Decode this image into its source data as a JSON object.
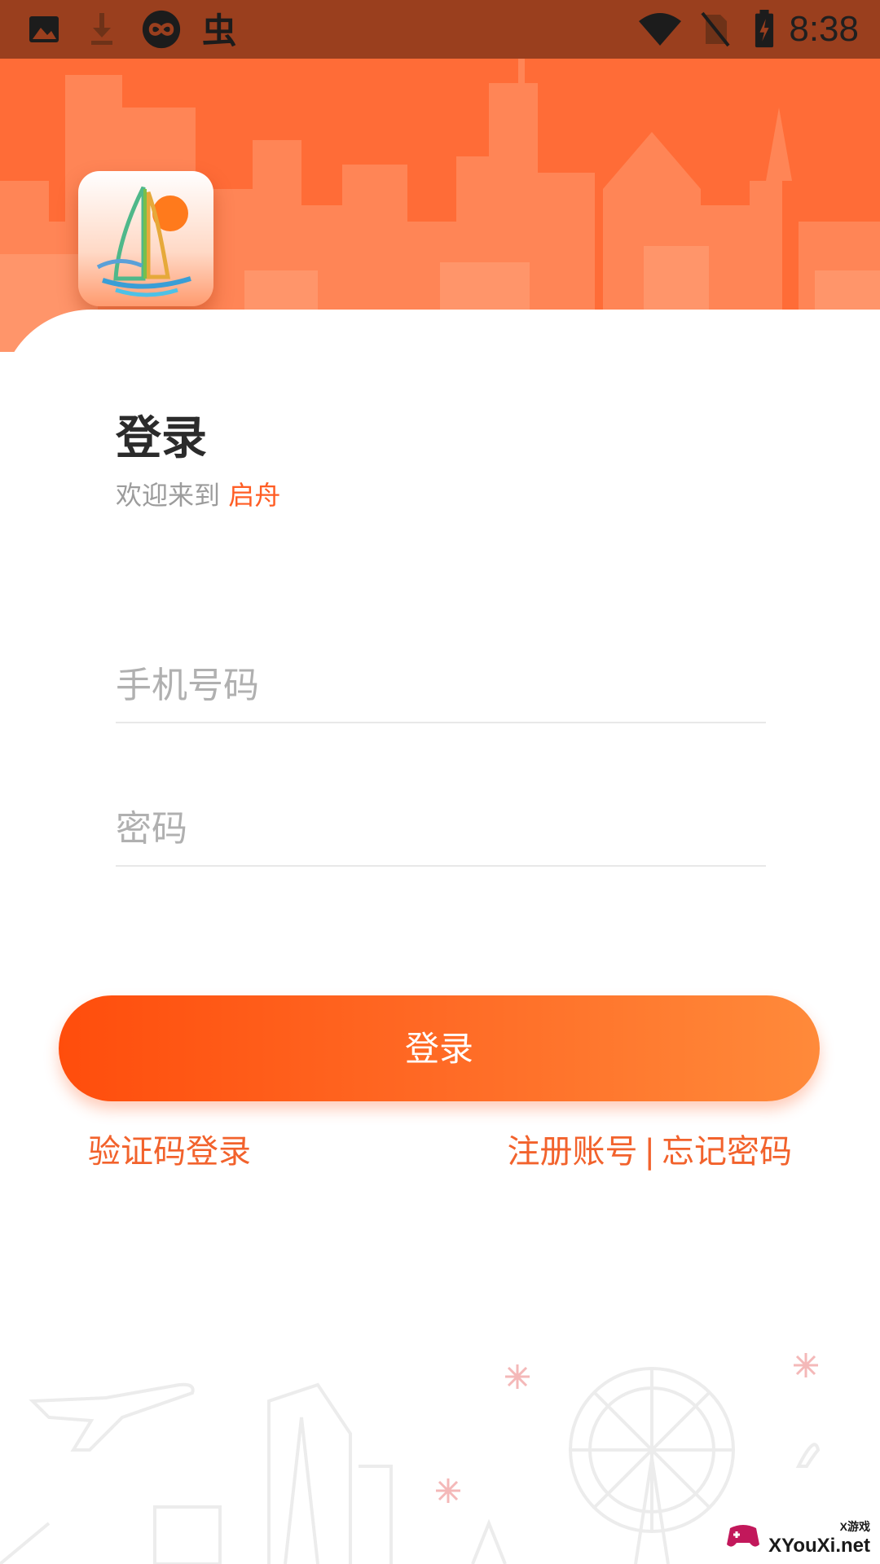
{
  "status_bar": {
    "time": "8:38",
    "left_icons": [
      "image-icon",
      "download-icon",
      "loop-icon",
      "bug-app-icon"
    ],
    "right_icons": [
      "wifi-icon",
      "no-sim-icon",
      "battery-charging-icon"
    ]
  },
  "header": {
    "logo": "sailboat-logo-icon"
  },
  "login": {
    "title": "登录",
    "welcome_prefix": "欢迎来到",
    "brand": "启舟",
    "phone_placeholder": "手机号码",
    "password_placeholder": "密码",
    "submit_label": "登录",
    "sms_login_label": "验证码登录",
    "register_label": "注册账号",
    "separator": "|",
    "forgot_label": "忘记密码"
  },
  "watermark": {
    "text": "XYouXi.net",
    "small": "X游戏"
  },
  "colors": {
    "accent": "#ff5d24",
    "header_bg": "#ff6c37",
    "status_bg": "#9a3f1e",
    "button_gradient_start": "#ff4d0c",
    "button_gradient_end": "#ff8a3a"
  }
}
